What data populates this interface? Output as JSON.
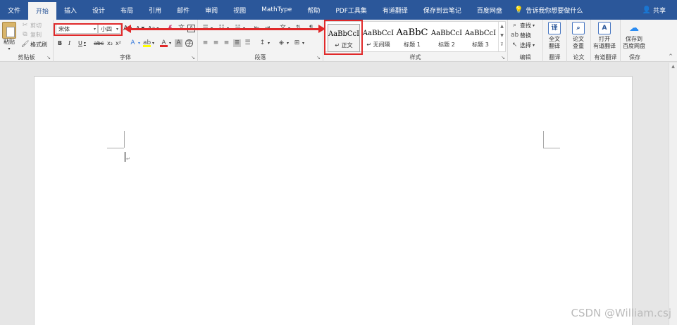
{
  "tabs": [
    {
      "label": "文件"
    },
    {
      "label": "开始",
      "active": true
    },
    {
      "label": "插入"
    },
    {
      "label": "设计"
    },
    {
      "label": "布局"
    },
    {
      "label": "引用"
    },
    {
      "label": "邮件"
    },
    {
      "label": "审阅"
    },
    {
      "label": "视图"
    },
    {
      "label": "MathType"
    },
    {
      "label": "帮助"
    },
    {
      "label": "PDF工具集"
    },
    {
      "label": "有道翻译"
    },
    {
      "label": "保存到云笔记"
    },
    {
      "label": "百度网盘"
    }
  ],
  "tellme": "告诉我你想要做什么",
  "share": "共享",
  "clipboard": {
    "paste": "粘贴",
    "cut": "剪切",
    "copy": "复制",
    "format_painter": "格式刷",
    "label": "剪贴板"
  },
  "font": {
    "name": "宋体",
    "size": "小四",
    "label": "字体",
    "grow": "A",
    "shrink": "A",
    "case": "Aa",
    "bold": "B",
    "italic": "I",
    "underline": "U",
    "strike": "abc",
    "sub": "x₂",
    "sup": "x²"
  },
  "paragraph": {
    "label": "段落"
  },
  "styles": {
    "label": "样式",
    "items": [
      {
        "sample": "AaBbCcI",
        "name": "↵ 正文"
      },
      {
        "sample": "AaBbCcI",
        "name": "↵ 无间隔"
      },
      {
        "sample": "AaBbC",
        "name": "标题 1"
      },
      {
        "sample": "AaBbCcI",
        "name": "标题 2"
      },
      {
        "sample": "AaBbCcI",
        "name": "标题 3"
      }
    ]
  },
  "editing": {
    "find": "查找",
    "replace": "替换",
    "select": "选择",
    "label": "编辑"
  },
  "translate": {
    "full_line1": "全文",
    "full_line2": "翻译",
    "label": "翻译"
  },
  "paper": {
    "check_line1": "论文",
    "check_line2": "查重",
    "label": "论文"
  },
  "youdao": {
    "open_line1": "打开",
    "open_line2": "有道翻译",
    "label": "有道翻译"
  },
  "baidu": {
    "save_line1": "保存到",
    "save_line2": "百度网盘",
    "label": "保存"
  },
  "document": {
    "para_mark": "↵"
  },
  "watermark": "CSDN @William.csj"
}
